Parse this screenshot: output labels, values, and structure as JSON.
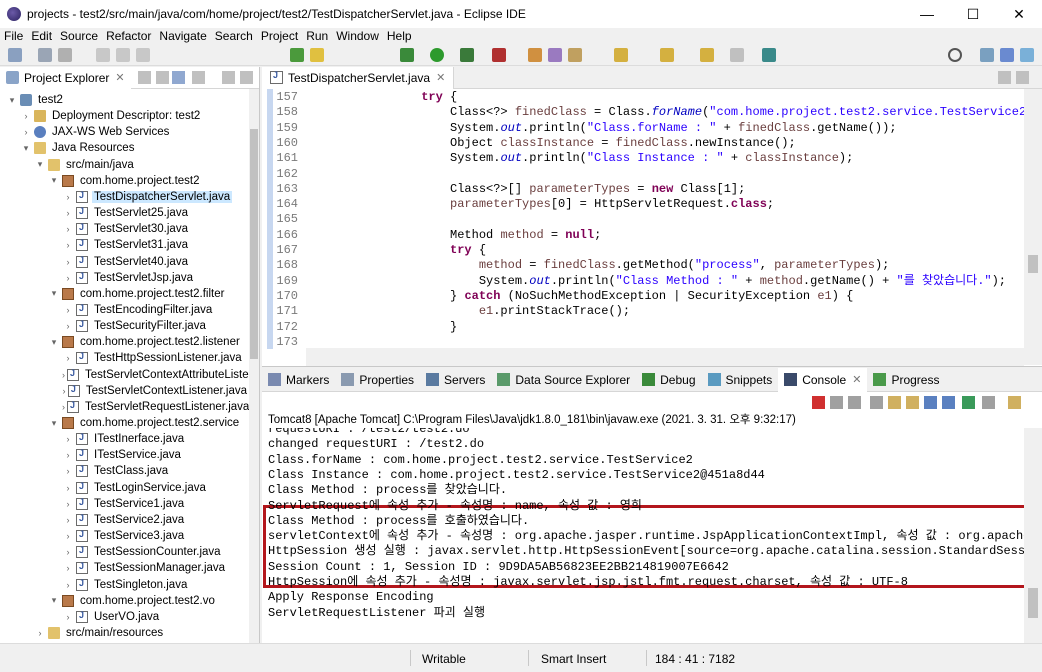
{
  "window": {
    "title": "projects - test2/src/main/java/com/home/project/test2/TestDispatcherServlet.java - Eclipse IDE",
    "minimize": "—",
    "maximize": "☐",
    "close": "✕"
  },
  "menu": [
    "File",
    "Edit",
    "Source",
    "Refactor",
    "Navigate",
    "Search",
    "Project",
    "Run",
    "Window",
    "Help"
  ],
  "project_explorer": {
    "title": "Project Explorer",
    "close": "✕",
    "tree": [
      {
        "label": "test2",
        "icon": "project-icon",
        "arrow": "▾"
      },
      {
        "label": "Deployment Descriptor: test2",
        "icon": "descriptor-icon",
        "arrow": "›"
      },
      {
        "label": "JAX-WS Web Services",
        "icon": "webservice-icon",
        "arrow": "›"
      },
      {
        "label": "Java Resources",
        "icon": "java-resources-icon",
        "arrow": "▾"
      },
      {
        "label": "src/main/java",
        "icon": "source-folder-icon",
        "arrow": "▾"
      },
      {
        "label": "com.home.project.test2",
        "icon": "package-icon",
        "arrow": "▾"
      },
      {
        "label": "TestDispatcherServlet.java",
        "icon": "java-file-icon",
        "arrow": "›",
        "selected": true
      },
      {
        "label": "TestServlet25.java",
        "icon": "java-file-icon",
        "arrow": "›"
      },
      {
        "label": "TestServlet30.java",
        "icon": "java-file-icon",
        "arrow": "›"
      },
      {
        "label": "TestServlet31.java",
        "icon": "java-file-icon",
        "arrow": "›"
      },
      {
        "label": "TestServlet40.java",
        "icon": "java-file-icon",
        "arrow": "›"
      },
      {
        "label": "TestServletJsp.java",
        "icon": "java-file-icon",
        "arrow": "›"
      },
      {
        "label": "com.home.project.test2.filter",
        "icon": "package-icon",
        "arrow": "▾"
      },
      {
        "label": "TestEncodingFilter.java",
        "icon": "java-file-icon",
        "arrow": "›"
      },
      {
        "label": "TestSecurityFilter.java",
        "icon": "java-file-icon",
        "arrow": "›"
      },
      {
        "label": "com.home.project.test2.listener",
        "icon": "package-icon",
        "arrow": "▾"
      },
      {
        "label": "TestHttpSessionListener.java",
        "icon": "java-file-icon",
        "arrow": "›"
      },
      {
        "label": "TestServletContextAttributeListe",
        "icon": "java-file-icon",
        "arrow": "›"
      },
      {
        "label": "TestServletContextListener.java",
        "icon": "java-file-icon",
        "arrow": "›"
      },
      {
        "label": "TestServletRequestListener.java",
        "icon": "java-file-icon",
        "arrow": "›"
      },
      {
        "label": "com.home.project.test2.service",
        "icon": "package-icon",
        "arrow": "▾"
      },
      {
        "label": "ITestInerface.java",
        "icon": "java-file-icon",
        "arrow": "›"
      },
      {
        "label": "ITestService.java",
        "icon": "java-file-icon",
        "arrow": "›"
      },
      {
        "label": "TestClass.java",
        "icon": "java-file-icon",
        "arrow": "›"
      },
      {
        "label": "TestLoginService.java",
        "icon": "java-file-icon",
        "arrow": "›"
      },
      {
        "label": "TestService1.java",
        "icon": "java-file-icon",
        "arrow": "›"
      },
      {
        "label": "TestService2.java",
        "icon": "java-file-icon",
        "arrow": "›"
      },
      {
        "label": "TestService3.java",
        "icon": "java-file-icon",
        "arrow": "›"
      },
      {
        "label": "TestSessionCounter.java",
        "icon": "java-file-icon",
        "arrow": "›"
      },
      {
        "label": "TestSessionManager.java",
        "icon": "java-file-icon",
        "arrow": "›"
      },
      {
        "label": "TestSingleton.java",
        "icon": "java-file-icon",
        "arrow": "›"
      },
      {
        "label": "com.home.project.test2.vo",
        "icon": "package-icon",
        "arrow": "▾"
      },
      {
        "label": "UserVO.java",
        "icon": "java-file-icon",
        "arrow": "›"
      },
      {
        "label": "src/main/resources",
        "icon": "source-folder-icon",
        "arrow": "›"
      }
    ]
  },
  "editor": {
    "tab": "TestDispatcherServlet.java",
    "close": "✕",
    "lines": [
      {
        "n": "157",
        "segs": [
          {
            "t": "                try ",
            "c": "kw"
          },
          {
            "t": "{",
            "c": ""
          }
        ]
      },
      {
        "n": "158",
        "segs": [
          {
            "t": "                    Class<?> ",
            "c": ""
          },
          {
            "t": "finedClass",
            "c": "var"
          },
          {
            "t": " = Class.",
            "c": ""
          },
          {
            "t": "forName",
            "c": "fld"
          },
          {
            "t": "(",
            "c": ""
          },
          {
            "t": "\"com.home.project.test2.service.TestService2\"",
            "c": "str"
          },
          {
            "t": ");",
            "c": ""
          }
        ]
      },
      {
        "n": "159",
        "segs": [
          {
            "t": "                    System.",
            "c": ""
          },
          {
            "t": "out",
            "c": "fld"
          },
          {
            "t": ".println(",
            "c": ""
          },
          {
            "t": "\"Class.forName : \"",
            "c": "str"
          },
          {
            "t": " + ",
            "c": ""
          },
          {
            "t": "finedClass",
            "c": "var"
          },
          {
            "t": ".getName());",
            "c": ""
          }
        ]
      },
      {
        "n": "160",
        "segs": [
          {
            "t": "                    Object ",
            "c": ""
          },
          {
            "t": "classInstance",
            "c": "var"
          },
          {
            "t": " = ",
            "c": ""
          },
          {
            "t": "finedClass",
            "c": "var"
          },
          {
            "t": ".newInstance();",
            "c": ""
          }
        ]
      },
      {
        "n": "161",
        "segs": [
          {
            "t": "                    System.",
            "c": ""
          },
          {
            "t": "out",
            "c": "fld"
          },
          {
            "t": ".println(",
            "c": ""
          },
          {
            "t": "\"Class Instance : \"",
            "c": "str"
          },
          {
            "t": " + ",
            "c": ""
          },
          {
            "t": "classInstance",
            "c": "var"
          },
          {
            "t": ");",
            "c": ""
          }
        ]
      },
      {
        "n": "162",
        "segs": [
          {
            "t": "",
            "c": ""
          }
        ]
      },
      {
        "n": "163",
        "segs": [
          {
            "t": "                    Class<?>[] ",
            "c": ""
          },
          {
            "t": "parameterTypes",
            "c": "var"
          },
          {
            "t": " = ",
            "c": ""
          },
          {
            "t": "new",
            "c": "kw"
          },
          {
            "t": " Class[1];",
            "c": ""
          }
        ]
      },
      {
        "n": "164",
        "segs": [
          {
            "t": "                    ",
            "c": ""
          },
          {
            "t": "parameterTypes",
            "c": "var"
          },
          {
            "t": "[0] = HttpServletRequest.",
            "c": ""
          },
          {
            "t": "class",
            "c": "kw"
          },
          {
            "t": ";",
            "c": ""
          }
        ]
      },
      {
        "n": "165",
        "segs": [
          {
            "t": "",
            "c": ""
          }
        ]
      },
      {
        "n": "166",
        "segs": [
          {
            "t": "                    Method ",
            "c": ""
          },
          {
            "t": "method",
            "c": "var"
          },
          {
            "t": " = ",
            "c": ""
          },
          {
            "t": "null",
            "c": "kw"
          },
          {
            "t": ";",
            "c": ""
          }
        ]
      },
      {
        "n": "167",
        "segs": [
          {
            "t": "                    ",
            "c": ""
          },
          {
            "t": "try",
            "c": "kw"
          },
          {
            "t": " {",
            "c": ""
          }
        ]
      },
      {
        "n": "168",
        "segs": [
          {
            "t": "                        ",
            "c": ""
          },
          {
            "t": "method",
            "c": "var"
          },
          {
            "t": " = ",
            "c": ""
          },
          {
            "t": "finedClass",
            "c": "var"
          },
          {
            "t": ".getMethod(",
            "c": ""
          },
          {
            "t": "\"process\"",
            "c": "str"
          },
          {
            "t": ", ",
            "c": ""
          },
          {
            "t": "parameterTypes",
            "c": "var"
          },
          {
            "t": ");",
            "c": ""
          }
        ]
      },
      {
        "n": "169",
        "segs": [
          {
            "t": "                        System.",
            "c": ""
          },
          {
            "t": "out",
            "c": "fld"
          },
          {
            "t": ".println(",
            "c": ""
          },
          {
            "t": "\"Class Method : \"",
            "c": "str"
          },
          {
            "t": " + ",
            "c": ""
          },
          {
            "t": "method",
            "c": "var"
          },
          {
            "t": ".getName() + ",
            "c": ""
          },
          {
            "t": "\"를 찾았습니다.\"",
            "c": "str"
          },
          {
            "t": ");",
            "c": ""
          }
        ]
      },
      {
        "n": "170",
        "segs": [
          {
            "t": "                    } ",
            "c": ""
          },
          {
            "t": "catch",
            "c": "kw"
          },
          {
            "t": " (NoSuchMethodException | SecurityException ",
            "c": ""
          },
          {
            "t": "e1",
            "c": "var"
          },
          {
            "t": ") {",
            "c": ""
          }
        ]
      },
      {
        "n": "171",
        "segs": [
          {
            "t": "                        ",
            "c": ""
          },
          {
            "t": "e1",
            "c": "var"
          },
          {
            "t": ".printStackTrace();",
            "c": ""
          }
        ]
      },
      {
        "n": "172",
        "segs": [
          {
            "t": "                    }",
            "c": ""
          }
        ]
      },
      {
        "n": "173",
        "segs": [
          {
            "t": "",
            "c": ""
          }
        ]
      }
    ]
  },
  "console_tabs": [
    {
      "label": "Markers",
      "icon": "markers-icon"
    },
    {
      "label": "Properties",
      "icon": "properties-icon"
    },
    {
      "label": "Servers",
      "icon": "servers-icon"
    },
    {
      "label": "Data Source Explorer",
      "icon": "data-source-icon"
    },
    {
      "label": "Debug",
      "icon": "debug-icon"
    },
    {
      "label": "Snippets",
      "icon": "snippets-icon"
    },
    {
      "label": "Console",
      "icon": "console-icon",
      "active": true,
      "close": "✕"
    },
    {
      "label": "Progress",
      "icon": "progress-icon"
    }
  ],
  "console": {
    "server_line": "Tomcat8 [Apache Tomcat] C:\\Program Files\\Java\\jdk1.8.0_181\\bin\\javaw.exe  (2021. 3. 31. 오후 9:32:17)",
    "lines": [
      "requestURI : /test2/test2.do",
      "changed requestURI : /test2.do",
      "Class.forName : com.home.project.test2.service.TestService2",
      "Class Instance : com.home.project.test2.service.TestService2@451a8d44",
      "Class Method : process를 찾았습니다.",
      "ServletRequest에 속성 추가 - 속성명 : name, 속성 값 : 영희",
      "Class Method : process를 호출하였습니다.",
      "servletContext에 속성 추가 - 속성명 : org.apache.jasper.runtime.JspApplicationContextImpl, 속성 값 : org.apache.jasper",
      "HttpSession 생성 실행 : javax.servlet.http.HttpSessionEvent[source=org.apache.catalina.session.StandardSessionFacad",
      "Session Count : 1, Session ID : 9D9DA5AB56823EE2BB214819007E6642",
      "HttpSession에 속성 추가 - 속성명 : javax.servlet.jsp.jstl.fmt.request.charset, 속성 값 : UTF-8",
      "Apply Response Encoding",
      "ServletRequestListener 파괴 실행"
    ]
  },
  "status": {
    "mode": "Writable",
    "insert": "Smart Insert",
    "position": "184 : 41 : 7182"
  },
  "colors": {
    "keyword": "#7f0055",
    "string": "#2a00ff",
    "highlight_box": "#b3161c"
  }
}
